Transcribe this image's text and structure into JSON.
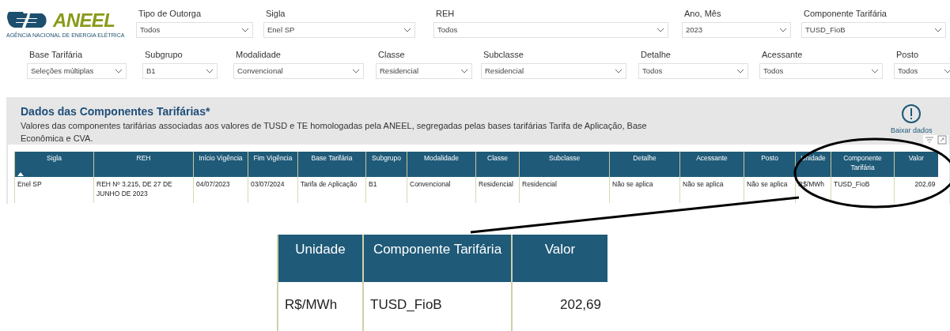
{
  "logo": {
    "name": "ANEEL",
    "subtitle": "AGÊNCIA NACIONAL DE ENERGIA ELÉTRICA"
  },
  "filters_row_1": [
    {
      "label": "Tipo de Outorga",
      "value": "Todos"
    },
    {
      "label": "Sigla",
      "value": "Enel SP"
    },
    {
      "label": "REH",
      "value": "Todos"
    },
    {
      "label": "Ano, Mês",
      "value": "2023"
    },
    {
      "label": "Componente Tarifária",
      "value": "TUSD_FioB"
    }
  ],
  "filters_row_2": [
    {
      "label": "Base Tarifária",
      "value": "Seleções múltiplas"
    },
    {
      "label": "Subgrupo",
      "value": "B1"
    },
    {
      "label": "Modalidade",
      "value": "Convencional"
    },
    {
      "label": "Classe",
      "value": "Residencial"
    },
    {
      "label": "Subclasse",
      "value": "Residencial"
    },
    {
      "label": "Detalhe",
      "value": "Todos"
    },
    {
      "label": "Acessante",
      "value": "Todos"
    },
    {
      "label": "Posto",
      "value": "Todos"
    }
  ],
  "panel": {
    "title": "Dados das Componentes Tarifárias*",
    "description": "Valores das componentes tarifárias associadas aos valores de TUSD e TE homologadas pela ANEEL, segregadas pelas bases tarifárias Tarifa de Aplicação, Base Econômica e CVA.",
    "download_button": "Baixar dados"
  },
  "table": {
    "columns": [
      {
        "label": "Sigla",
        "sorted": true
      },
      {
        "label": "REH",
        "sorted": false
      },
      {
        "label": "Início Vigência",
        "sorted": false
      },
      {
        "label": "Fim Vigência",
        "sorted": false
      },
      {
        "label": "Base Tarifária",
        "sorted": false
      },
      {
        "label": "Subgrupo",
        "sorted": false
      },
      {
        "label": "Modalidade",
        "sorted": false
      },
      {
        "label": "Classe",
        "sorted": false
      },
      {
        "label": "Subclasse",
        "sorted": false
      },
      {
        "label": "Detalhe",
        "sorted": false
      },
      {
        "label": "Acessante",
        "sorted": false
      },
      {
        "label": "Posto",
        "sorted": false
      },
      {
        "label": "Unidade",
        "sorted": false
      },
      {
        "label": "Componente Tarifária",
        "sorted": false
      },
      {
        "label": "Valor",
        "sorted": false
      }
    ],
    "rows": [
      [
        "Enel SP",
        "REH Nº 3.215, DE 27 DE JUNHO DE 2023",
        "04/07/2023",
        "03/07/2024",
        "Tarifa de Aplicação",
        "B1",
        "Convencional",
        "Residencial",
        "Residencial",
        "Não se aplica",
        "Não se aplica",
        "Não se aplica",
        "R$/MWh",
        "TUSD_FioB",
        "202,69"
      ]
    ]
  },
  "zoom_inset": {
    "columns": [
      "Unidade",
      "Componente Tarifária",
      "Valor"
    ],
    "row": [
      "R$/MWh",
      "TUSD_FioB",
      "202,69"
    ]
  }
}
